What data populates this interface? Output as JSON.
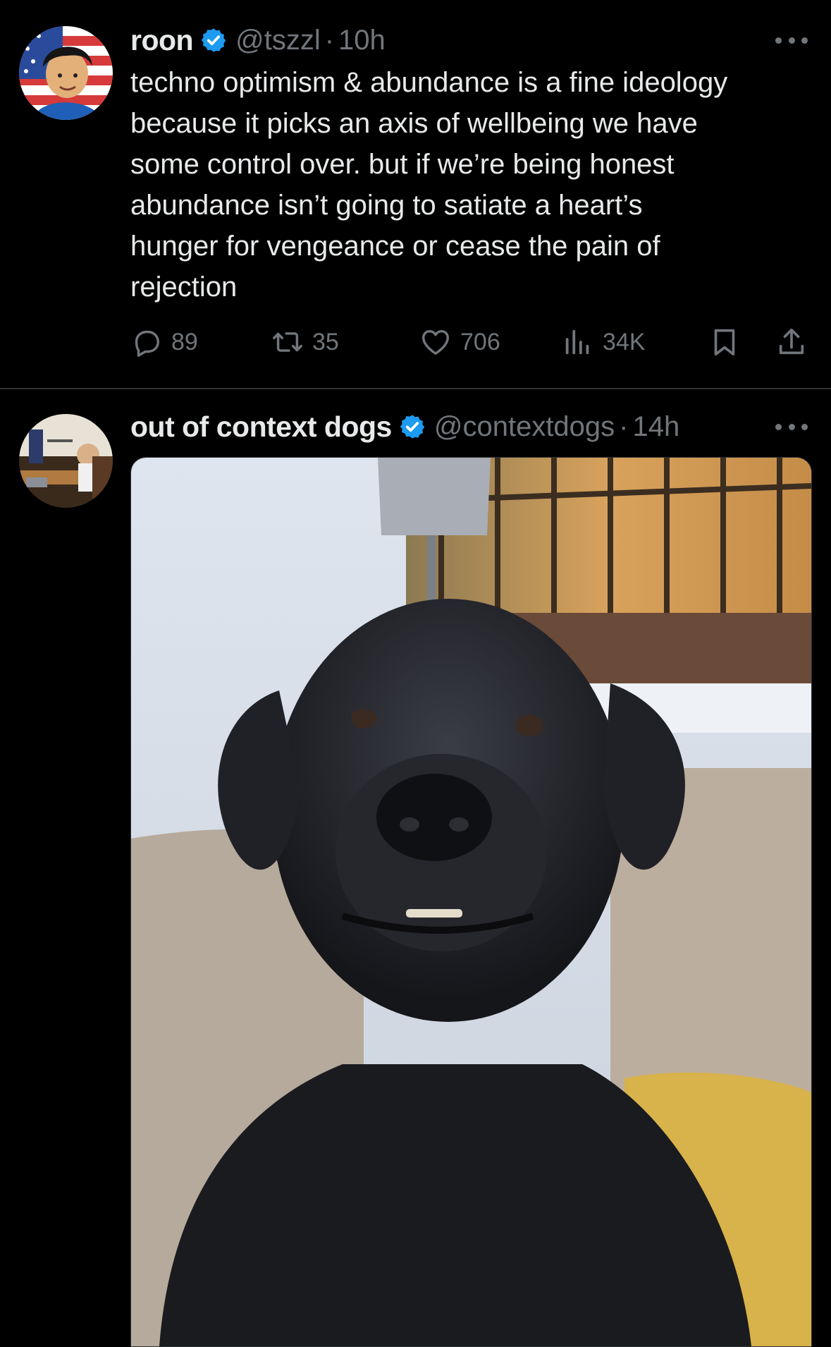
{
  "tweets": [
    {
      "display_name": "roon",
      "handle": "@tszzl",
      "separator": "·",
      "time": "10h",
      "text": "techno optimism & abundance is a fine ideology\nbecause it picks an axis of wellbeing we have\nsome control over. but if we’re being honest\nabundance isn’t going to satiate a heart’s\nhunger for vengeance or cease the pain of\nrejection",
      "verified": true,
      "stats": {
        "replies": "89",
        "reposts": "35",
        "likes": "706",
        "views": "34K"
      }
    },
    {
      "display_name": "out of context dogs",
      "handle": "@contextdogs",
      "separator": "·",
      "time": "14h",
      "verified": true,
      "media": "photo of a black labrador dog on a sofa"
    }
  ],
  "colors": {
    "background": "#000000",
    "primary_text": "#e7e9ea",
    "secondary_text": "#71767b",
    "verified_badge": "#1d9bf0",
    "divider": "#2f3336"
  },
  "icons": [
    "more-icon",
    "verified-badge-icon",
    "reply-icon",
    "repost-icon",
    "like-icon",
    "views-icon",
    "bookmark-icon",
    "share-icon"
  ]
}
